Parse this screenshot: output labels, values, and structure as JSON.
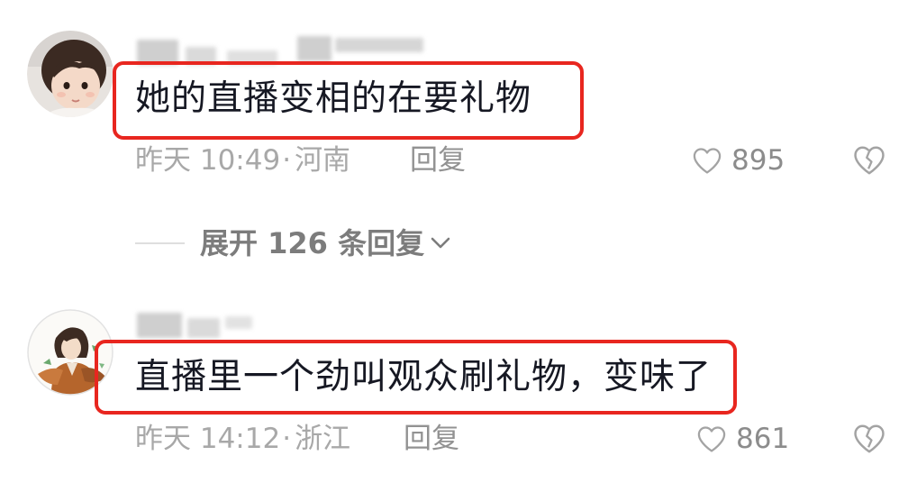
{
  "colors": {
    "highlight": "#e8261f",
    "text": "#161823",
    "meta": "#a8a8a8"
  },
  "icons": {
    "like": "heart-outline-icon",
    "dislike": "broken-heart-icon",
    "expand": "chevron-down-icon"
  },
  "comments": [
    {
      "text": "她的直播变相的在要礼物",
      "time": "昨天 10:49",
      "separator": "·",
      "location": "河南",
      "reply_label": "回复",
      "like_count": "895"
    },
    {
      "text": "直播里一个劲叫观众刷礼物，变味了",
      "time": "昨天 14:12",
      "separator": "·",
      "location": "浙江",
      "reply_label": "回复",
      "like_count": "861"
    }
  ],
  "expand_replies": {
    "label": "展开 126 条回复"
  }
}
